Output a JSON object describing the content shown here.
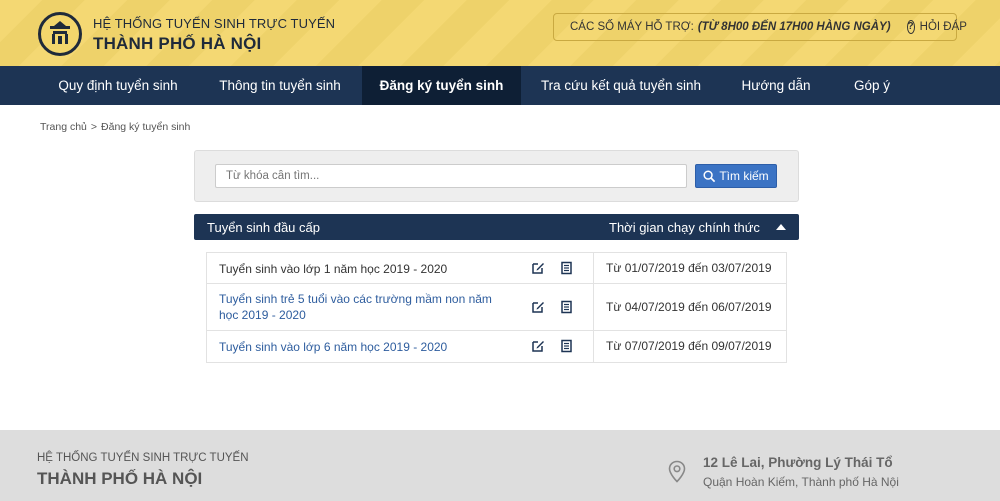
{
  "header": {
    "brand_top": "HỆ THỐNG TUYỂN SINH TRỰC TUYẾN",
    "brand_main": "THÀNH PHỐ HÀ NỘI",
    "support_label": "CÁC SỐ MÁY HỖ TRỢ:",
    "support_hours": "(TỪ 8H00 ĐẾN 17H00 HÀNG NGÀY)",
    "faq_label": "HỎI ĐÁP"
  },
  "nav": {
    "items": [
      {
        "label": "Quy định tuyển sinh"
      },
      {
        "label": "Thông tin tuyển sinh"
      },
      {
        "label": "Đăng ký tuyển sinh"
      },
      {
        "label": "Tra cứu kết quả tuyển sinh"
      },
      {
        "label": "Hướng dẫn"
      },
      {
        "label": "Góp ý"
      }
    ],
    "active_index": 2
  },
  "breadcrumb": {
    "home": "Trang chủ",
    "separator": ">",
    "current": "Đăng ký tuyển sinh"
  },
  "search": {
    "placeholder": "Từ khóa cần tìm...",
    "button_label": "Tìm kiếm"
  },
  "table": {
    "header_left": "Tuyển sinh đầu cấp",
    "header_right": "Thời gian chạy chính thức",
    "rows": [
      {
        "name": "Tuyển sinh vào lớp 1 năm học 2019 - 2020",
        "period": "Từ 01/07/2019 đến 03/07/2019"
      },
      {
        "name": "Tuyển sinh trẻ 5 tuổi vào các trường mầm non năm học 2019 - 2020",
        "period": "Từ 04/07/2019 đến 06/07/2019"
      },
      {
        "name": "Tuyển sinh vào lớp 6 năm học 2019 - 2020",
        "period": "Từ 07/07/2019 đến 09/07/2019"
      }
    ]
  },
  "footer": {
    "brand_top": "HỆ THỐNG TUYỂN SINH TRỰC TUYẾN",
    "brand_main": "THÀNH PHỐ HÀ NỘI",
    "address_line1": "12 Lê Lai, Phường Lý Thái Tổ",
    "address_line2": "Quận Hoàn Kiếm, Thành phố Hà Nội"
  },
  "icons": {
    "logo": "hanoi-emblem-icon",
    "phone": "phone-icon",
    "faq": "question-circle-icon",
    "search": "search-icon",
    "edit": "edit-icon",
    "document": "document-icon",
    "sort": "caret-up-icon",
    "location": "map-pin-icon"
  },
  "colors": {
    "header_bg": "#f3d66c",
    "nav_bg": "#1d3454",
    "nav_active_bg": "#0e1f35",
    "search_button": "#3b73c4",
    "link": "#2e5d9e",
    "footer_bg": "#dddddd"
  }
}
